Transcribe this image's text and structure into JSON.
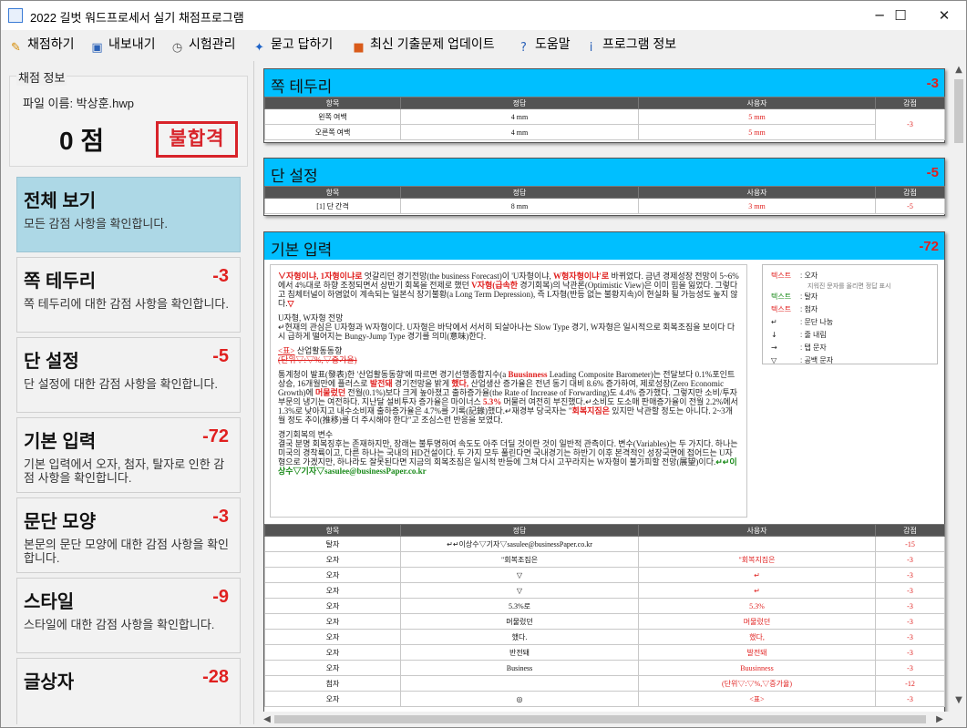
{
  "window": {
    "title": "2022 길벗 워드프로세서 실기 채점프로그램",
    "minimize": "─",
    "maximize": "☐",
    "close": "✕"
  },
  "menu": [
    {
      "label": "채점하기",
      "icon": "pencil-icon",
      "glyph": "✎",
      "color": "#d58a00"
    },
    {
      "label": "내보내기",
      "icon": "save-icon",
      "glyph": "▣",
      "color": "#2b62b8"
    },
    {
      "label": "시험관리",
      "icon": "clock-icon",
      "glyph": "◷",
      "color": "#555555"
    },
    {
      "label": "묻고 답하기",
      "icon": "qa-icon",
      "glyph": "✦",
      "color": "#1e63c8"
    },
    {
      "label": "최신 기출문제 업데이트",
      "icon": "gift-icon",
      "glyph": "■",
      "color": "#d95b1a"
    },
    {
      "label": "도움말",
      "icon": "help-icon",
      "glyph": "?",
      "color": "#2b62b8"
    },
    {
      "label": "프로그램 정보",
      "icon": "info-icon",
      "glyph": "i",
      "color": "#2b62b8"
    }
  ],
  "sidebar": {
    "section_label": "채점 정보",
    "file_name": "파일 이름: 박상훈.hwp",
    "score": "0 점",
    "stamp": "불합격",
    "cards": [
      {
        "title": "전체 보기",
        "score": "",
        "desc": "모든 감점 사항을 확인합니다."
      },
      {
        "title": "쪽 테두리",
        "score": "-3",
        "desc": "쪽 테두리에 대한 감점 사항을 확인합니다."
      },
      {
        "title": "단 설정",
        "score": "-5",
        "desc": "단 설정에 대한 감점 사항을 확인합니다."
      },
      {
        "title": "기본 입력",
        "score": "-72",
        "desc": "기본 입력에서 오자, 첨자, 탈자로 인한 감점 사항을 확인합니다."
      },
      {
        "title": "문단 모양",
        "score": "-3",
        "desc": "본문의 문단 모양에 대한 감점 사항을 확인합니다."
      },
      {
        "title": "스타일",
        "score": "-9",
        "desc": "스타일에 대한 감점 사항을 확인합니다."
      },
      {
        "title": "글상자",
        "score": "-28",
        "desc": ""
      }
    ]
  },
  "panels": {
    "border": {
      "title": "쪽 테두리",
      "score": "-3",
      "headers": [
        "항목",
        "정답",
        "사용자",
        "감점"
      ],
      "rows": [
        {
          "item": "왼쪽 여백",
          "answer": "4 mm",
          "user": "5 mm"
        },
        {
          "item": "오른쪽 여백",
          "answer": "4 mm",
          "user": "5 mm"
        }
      ],
      "deduction": "-3"
    },
    "columns": {
      "title": "단 설정",
      "score": "-5",
      "headers": [
        "항목",
        "정답",
        "사용자",
        "감점"
      ],
      "rows": [
        {
          "item": "[1] 단 간격",
          "answer": "8 mm",
          "user": "3 mm",
          "deduction": "-5"
        }
      ]
    },
    "input": {
      "title": "기본 입력",
      "score": "-72",
      "doc": {
        "p1_red1": "∨자형이냐, 1자형이냐로",
        "p1_a": " 엇갈리던 경기전망(the business Forecast)이 'U자형이냐, ",
        "p1_red2": "W형자형이냐'로",
        "p1_b": " 바뀌었다. 금년 경제성장 전망이 5~6%에서 4%대로 하향 조정되면서 상반기 회복을 전제로 했던 ",
        "p1_red3": "V자형(급속한",
        "p1_c": " 경기회복)의 낙관론(Optimistic View)은 이미 힘을 잃었다. 그렇다고 침체터널이 하염없이 계속되는 일본식 장기불황(a Long Term Depression), 즉 L자형(반등 없는 불황지속)이 현실화 될 가능성도 높지 않다.",
        "p1_red4": "▽",
        "p2_head": "U자형, W자형 전망",
        "p2_a": "↵현재의 관심은 U자형과 W자형이다. U자형은 바닥에서 서서히 되살아나는 Slow Type 경기, W자형은 일시적으로 회복조짐을 보이다 다시 급하게 떨어지는 Bungy-Jump Type 경기를 의미(意味)한다.",
        "p3_tag": "<표>",
        "p3_head": " 산업활동동향",
        "p3_red": "(단위▽:▽%,▽증가율)",
        "p4_a": "통계청이 발표(發表)한 '산업활동동향'에 따르면 경기선행종합지수(a ",
        "p4_red1": "Buusinness",
        "p4_b": " Leading Composite Barometer)는 전달보다 0.1%포인트 상승, 16개월만에 플러스로 ",
        "p4_red2": "발전돼",
        "p4_c": " 경기전망을 밝게 ",
        "p4_red3": "했다,",
        "p4_d": " 산업생산 증가율은 전년 동기 대비 8.6% 증가하여, 제로성장(Zero Economic Growth)에 ",
        "p4_red4": "머물렀던",
        "p4_e": " 전월(0.1%)보다 크게 높아졌고 출하증가율(the Rate of Increase of Forwarding)도 4.4% 증가했다. 그렇지만 소비/투자 부문의 냉기는 여전하다. 지난달 설비투자 증가율은 마이너스 ",
        "p4_red5": "5.3%",
        "p4_f": " 머물러 여전히 부진했다.↵소비도 도소매 판매증가율이 전월 2.2%에서 1.3%로 낮아지고 내수소비재 출하증가율은 4.7%를 기록(記錄)했다.↵재경부 당국자는 \"",
        "p4_red6": "회복지짐은",
        "p4_g": " 있지만 낙관할 정도는 아니다. 2~3개월 정도 추이(推移)를 더 주시해야 한다\"고 조심스런 반응을 보였다.",
        "p5_head": "경기회복의 변수",
        "p5_a": "결국 분명 회복징후는 존재하지만, 장래는 불투명하여 속도도 아주 더딜 것이란 것이 일반적 관측이다. 변수(Variables)는 두 가지다. 하나는 미국의 경착륙이고, 다른 하나는 국내의 HD건설이다. 두 가지 모두 풀린다면 국내경기는 하반기 이후 본격적인 성장국면에 접어드는 U자형으로 가겠지만, 하나라도 잘못된다면 지금의 회복조짐은 일시적 반등에 그쳐 다시 고꾸라지는 W자형이 불가피할 전망(展望)이다.",
        "p5_green": "↵↵이상수▽기자▽sasulee@businessPaper.co.kr"
      },
      "legend": [
        {
          "key": "텍스트",
          "style": "kr",
          "label": ": 오자",
          "sub": "지워진 문자를 올리면 정답 표시"
        },
        {
          "key": "텍스트",
          "style": "kg",
          "label": ": 탈자"
        },
        {
          "key": "텍스트",
          "style": "kr",
          "label": ": 첨자"
        },
        {
          "key": "↵",
          "style": "",
          "label": ": 문단 나눔"
        },
        {
          "key": "↓",
          "style": "",
          "label": ": 줄 내림"
        },
        {
          "key": "→",
          "style": "",
          "label": ": 탭 문자"
        },
        {
          "key": "▽",
          "style": "",
          "label": ": 공백 문자"
        }
      ],
      "headers": [
        "항목",
        "정답",
        "사용자",
        "감점"
      ],
      "rows": [
        {
          "item": "탈자",
          "answer": "↵↵이상수▽기자▽sasulee@businessPaper.co.kr",
          "user": "",
          "deduction": "-15"
        },
        {
          "item": "오자",
          "answer": "\"회복조짐은",
          "user": "\"회복지짐은",
          "deduction": "-3"
        },
        {
          "item": "오자",
          "answer": "▽",
          "user": "↵",
          "deduction": "-3"
        },
        {
          "item": "오자",
          "answer": "▽",
          "user": "↵",
          "deduction": "-3"
        },
        {
          "item": "오자",
          "answer": "5.3%로",
          "user": "5.3%",
          "deduction": "-3"
        },
        {
          "item": "오자",
          "answer": "머물렀던",
          "user": "머물렀던",
          "deduction": "-3"
        },
        {
          "item": "오자",
          "answer": "했다.",
          "user": "했다,",
          "deduction": "-3"
        },
        {
          "item": "오자",
          "answer": "반전돼",
          "user": "발전돼",
          "deduction": "-3"
        },
        {
          "item": "오자",
          "answer": "Business",
          "user": "Buusinness",
          "deduction": "-3"
        },
        {
          "item": "첨자",
          "answer": "",
          "user": "(단위▽:▽%,▽증가율)",
          "deduction": "-12"
        },
        {
          "item": "오자",
          "answer": "◎",
          "user": "<표>",
          "deduction": "-3"
        }
      ]
    }
  },
  "scroll": {
    "up": "▲",
    "down": "▼",
    "left": "◀",
    "right": "▶"
  }
}
